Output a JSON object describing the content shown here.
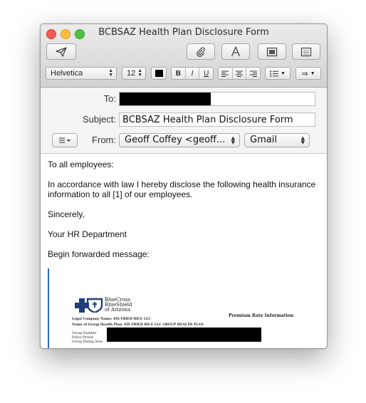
{
  "window": {
    "title": "BCBSAZ Health Plan Disclosure Form"
  },
  "toolbar": {
    "send_icon": "paper-plane-icon",
    "attach_icon": "paperclip-icon",
    "fonts_icon": "font-A-icon",
    "photo_icon": "photo-browser-icon",
    "stationery_icon": "stationery-icon"
  },
  "format_bar": {
    "font": "Helvetica",
    "size": "12",
    "color": "#000000",
    "bold": "B",
    "italic": "I",
    "underline": "U",
    "indent_icon": "indent-icon"
  },
  "header": {
    "to_label": "To:",
    "subject_label": "Subject:",
    "subject_value": "BCBSAZ Health Plan Disclosure Form",
    "from_label": "From:",
    "from_value": "Geoff Coffey <geoff...",
    "account_value": "Gmail"
  },
  "body": {
    "greeting": "To all employees:",
    "paragraph": "In accordance with law I hereby disclose the following health insurance information to all [1] of our employees.",
    "closing": "Sincerely,",
    "signature": "Your HR Department",
    "forwarded": "Begin forwarded message:"
  },
  "attachment": {
    "brand_line1": "BlueCross",
    "brand_line2": "BlueShield",
    "brand_line3": "of Arizona",
    "section_title": "Premium Rate Information",
    "company_line": "Legal Company Name: SIX FRIED RICE LLC",
    "plan_line": "Name of Group Health Plan: SIX FRIED RICE LLC GROUP HEALTH PLAN",
    "field1": "Group Number",
    "field2": "Policy Period",
    "field3": "Group Rating Area"
  },
  "colors": {
    "quote_bar": "#2c6bb3",
    "bcbs_blue": "#1f3f7a"
  }
}
